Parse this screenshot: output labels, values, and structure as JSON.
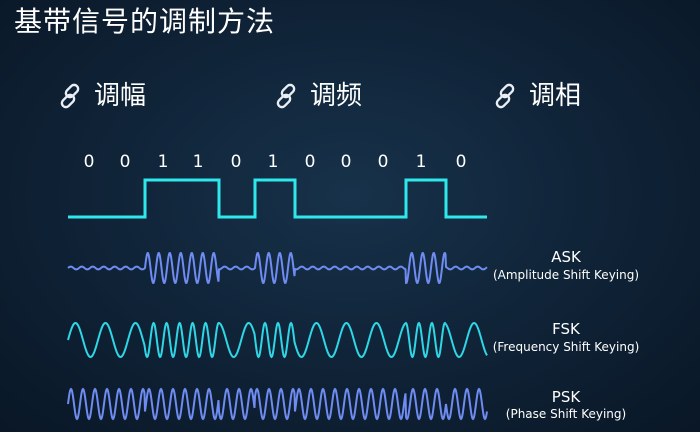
{
  "title": "基带信号的调制方法",
  "methods": [
    {
      "label": "调幅",
      "icon": "link-icon"
    },
    {
      "label": "调频",
      "icon": "link-icon"
    },
    {
      "label": "调相",
      "icon": "link-icon"
    }
  ],
  "bits": [
    "0",
    "0",
    "1",
    "1",
    "0",
    "1",
    "0",
    "0",
    "0",
    "1",
    "0"
  ],
  "signals": [
    {
      "name": "ASK",
      "full": "(Amplitude Shift Keying)"
    },
    {
      "name": "FSK",
      "full": "(Frequency Shift Keying)"
    },
    {
      "name": "PSK",
      "full": "(Phase Shift Keying)"
    }
  ],
  "colors": {
    "digital": "#2ee8ec",
    "ask": "#6f8cf2",
    "fsk": "#2fd6e6",
    "psk": "#6f8cf2",
    "text": "#ffffff"
  }
}
